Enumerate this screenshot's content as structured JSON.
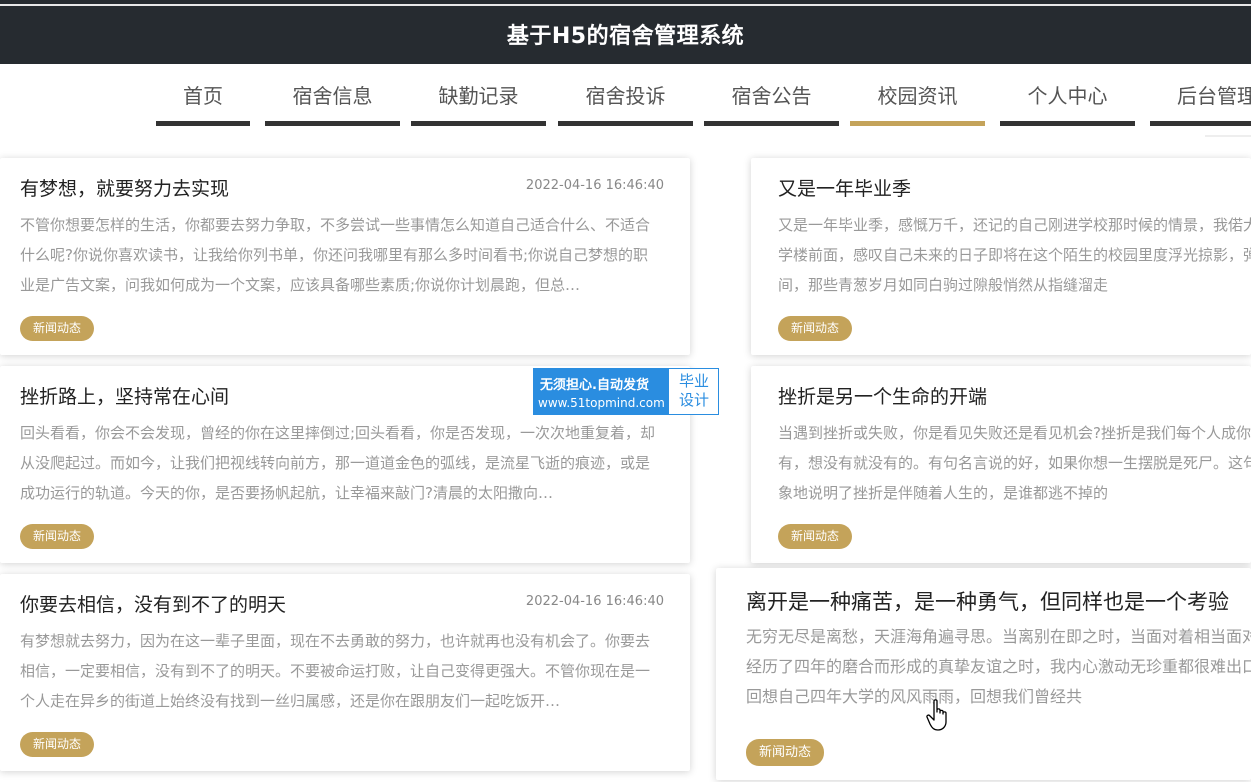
{
  "header": {
    "title": "基于H5的宿舍管理系统"
  },
  "nav": {
    "items": [
      {
        "label": "首页"
      },
      {
        "label": "宿舍信息"
      },
      {
        "label": "缺勤记录"
      },
      {
        "label": "宿舍投诉"
      },
      {
        "label": "宿舍公告"
      },
      {
        "label": "校园资讯"
      },
      {
        "label": "个人中心"
      },
      {
        "label": "后台管理"
      }
    ],
    "active": "校园资讯"
  },
  "articles": [
    {
      "title": "有梦想，就要努力去实现",
      "date": "2022-04-16 16:46:40",
      "body": "不管你想要怎样的生活，你都要去努力争取，不多尝试一些事情怎么知道自己适合什么、不适合什么呢?你说你喜欢读书，让我给你列书单，你还问我哪里有那么多时间看书;你说自己梦想的职业是广告文案，问我如何成为一个文案，应该具备哪些素质;你说你计划晨跑，但总…",
      "tag": "新闻动态"
    },
    {
      "title": "又是一年毕业季",
      "date": "",
      "body": "又是一年毕业季，感慨万千，还记的自己刚进学校那时候的情景，我偌大的教学楼前面，感叹自己未来的日子即将在这个陌生的校园里度浮光掠影，弹指之间，那些青葱岁月如同白驹过隙般悄然从指缝溜走",
      "tag": "新闻动态"
    },
    {
      "title": "挫折路上，坚持常在心间",
      "date": "",
      "body": "回头看看，你会不会发现，曾经的你在这里摔倒过;回头看看，你是否发现，一次次地重复着，却从没爬起过。而如今，让我们把视线转向前方，那一道道金色的弧线，是流星飞逝的痕迹，或是成功运行的轨道。今天的你，是否要扬帆起航，让幸福来敲门?清晨的太阳撒向…",
      "tag": "新闻动态"
    },
    {
      "title": "挫折是另一个生命的开端",
      "date": "",
      "body": "当遇到挫折或失败，你是看见失败还是看见机会?挫折是我们每个人成你想有就有，想没有就没有的。有句名言说的好，如果你想一生摆脱是死尸。这句话形象地说明了挫折是伴随着人生的，是谁都逃不掉的",
      "tag": "新闻动态"
    },
    {
      "title": "你要去相信，没有到不了的明天",
      "date": "2022-04-16 16:46:40",
      "body": "有梦想就去努力，因为在这一辈子里面，现在不去勇敢的努力，也许就再也没有机会了。你要去相信，一定要相信，没有到不了的明天。不要被命运打败，让自己变得更强大。不管你现在是一个人走在异乡的街道上始终没有找到一丝归属感，还是你在跟朋友们一起吃饭开…",
      "tag": "新闻动态"
    },
    {
      "title": "离开是一种痛苦，是一种勇气，但同样也是一个考验",
      "date": "",
      "body": "无穷无尽是离愁，天涯海角遍寻思。当离别在即之时，当面对着相当面对着经历了四年的磨合而形成的真挚友谊之时，我内心激动无珍重都很难出口。回想自己四年大学的风风雨雨，回想我们曾经共",
      "tag": "新闻动态"
    }
  ],
  "watermark": {
    "line1": "无须担心.自动发货",
    "line2": "www.51topmind.com",
    "side": "毕业设计"
  },
  "colors": {
    "accent": "#c4a35a",
    "header_bg": "#262b30",
    "watermark_blue": "#2a8de0"
  },
  "icons": {
    "cursor": "hand-pointer-icon"
  }
}
